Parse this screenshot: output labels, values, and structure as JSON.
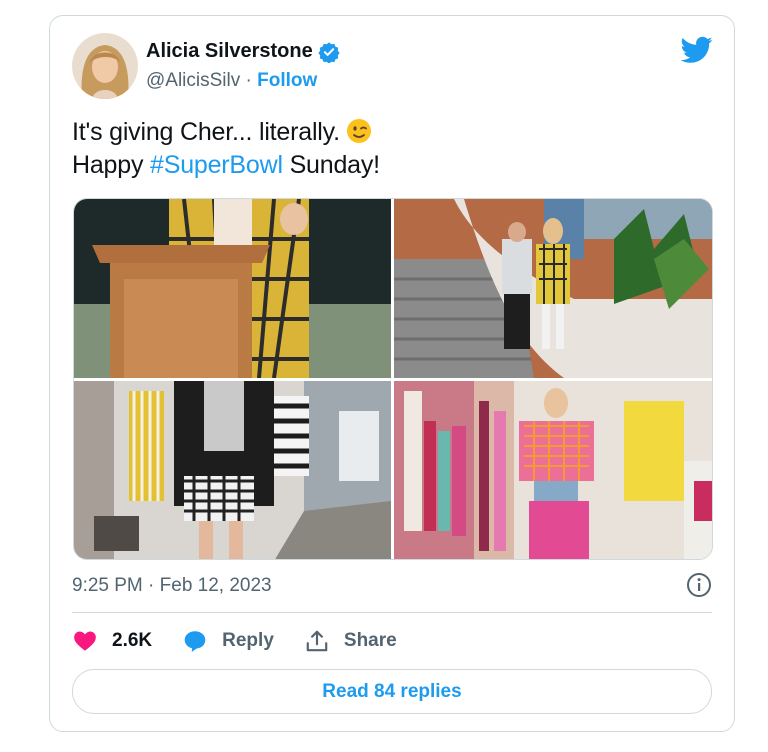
{
  "author": {
    "name": "Alicia Silverstone",
    "handle": "@AlicisSilv",
    "separator": " · ",
    "follow_label": "Follow"
  },
  "tweet": {
    "line1_text": "It's giving Cher... literally.",
    "line2_prefix": "Happy ",
    "hashtag": "#SuperBowl",
    "line2_suffix": " Sunday!"
  },
  "media": {
    "photos": [
      "podium-photo",
      "staircase-photo",
      "street-shopping-photo",
      "boutique-photo"
    ]
  },
  "timestamp": "9:25 PM · Feb 12, 2023",
  "actions": {
    "like_count": "2.6K",
    "reply_label": "Reply",
    "share_label": "Share"
  },
  "read_replies_label": "Read 84 replies",
  "colors": {
    "accent": "#1d9bf0",
    "like": "#f91880",
    "text": "#0f1419",
    "secondary": "#536471",
    "border": "#cfd9de"
  },
  "icons": [
    "twitter-bird-icon",
    "verified-badge-icon",
    "wink-emoji-icon",
    "info-icon",
    "heart-icon",
    "reply-bubble-icon",
    "share-icon"
  ]
}
